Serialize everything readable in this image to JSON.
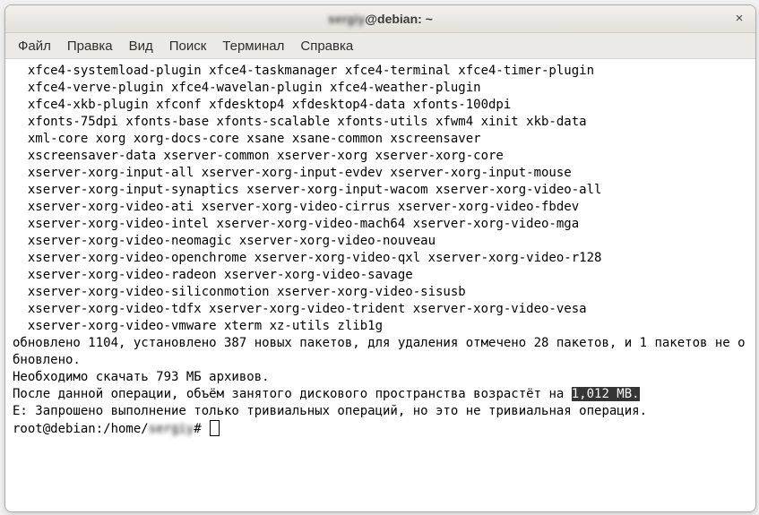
{
  "window": {
    "title_user_blur": "sergiy",
    "title_suffix": "@debian: ~",
    "close_glyph": "×"
  },
  "menu": {
    "file": "Файл",
    "edit": "Правка",
    "view": "Вид",
    "search": "Поиск",
    "terminal": "Терминал",
    "help": "Справка"
  },
  "term": {
    "pkg_lines": [
      "xfce4-systemload-plugin xfce4-taskmanager xfce4-terminal xfce4-timer-plugin",
      "xfce4-verve-plugin xfce4-wavelan-plugin xfce4-weather-plugin",
      "xfce4-xkb-plugin xfconf xfdesktop4 xfdesktop4-data xfonts-100dpi",
      "xfonts-75dpi xfonts-base xfonts-scalable xfonts-utils xfwm4 xinit xkb-data",
      "xml-core xorg xorg-docs-core xsane xsane-common xscreensaver",
      "xscreensaver-data xserver-common xserver-xorg xserver-xorg-core",
      "xserver-xorg-input-all xserver-xorg-input-evdev xserver-xorg-input-mouse",
      "xserver-xorg-input-synaptics xserver-xorg-input-wacom xserver-xorg-video-all",
      "xserver-xorg-video-ati xserver-xorg-video-cirrus xserver-xorg-video-fbdev",
      "xserver-xorg-video-intel xserver-xorg-video-mach64 xserver-xorg-video-mga",
      "xserver-xorg-video-neomagic xserver-xorg-video-nouveau",
      "xserver-xorg-video-openchrome xserver-xorg-video-qxl xserver-xorg-video-r128",
      "xserver-xorg-video-radeon xserver-xorg-video-savage",
      "xserver-xorg-video-siliconmotion xserver-xorg-video-sisusb",
      "xserver-xorg-video-tdfx xserver-xorg-video-trident xserver-xorg-video-vesa",
      "xserver-xorg-video-vmware xterm xz-utils zlib1g"
    ],
    "summary1": "обновлено 1104, установлено 387 новых пакетов, для удаления отмечено 28 пакетов, и 1 пакетов не обновлено.",
    "download": "Необходимо скачать 793 MБ архивов.",
    "disk_pre": "После данной операции, объём занятого дискового пространства возрастёт на ",
    "disk_hl": "1,012 MB.",
    "error": "E: Запрошено выполнение только тривиальных операций, но это не тривиальная операция.",
    "prompt_pre": "root@debian:/home/",
    "prompt_blur": "sergiy",
    "prompt_post": "# "
  }
}
